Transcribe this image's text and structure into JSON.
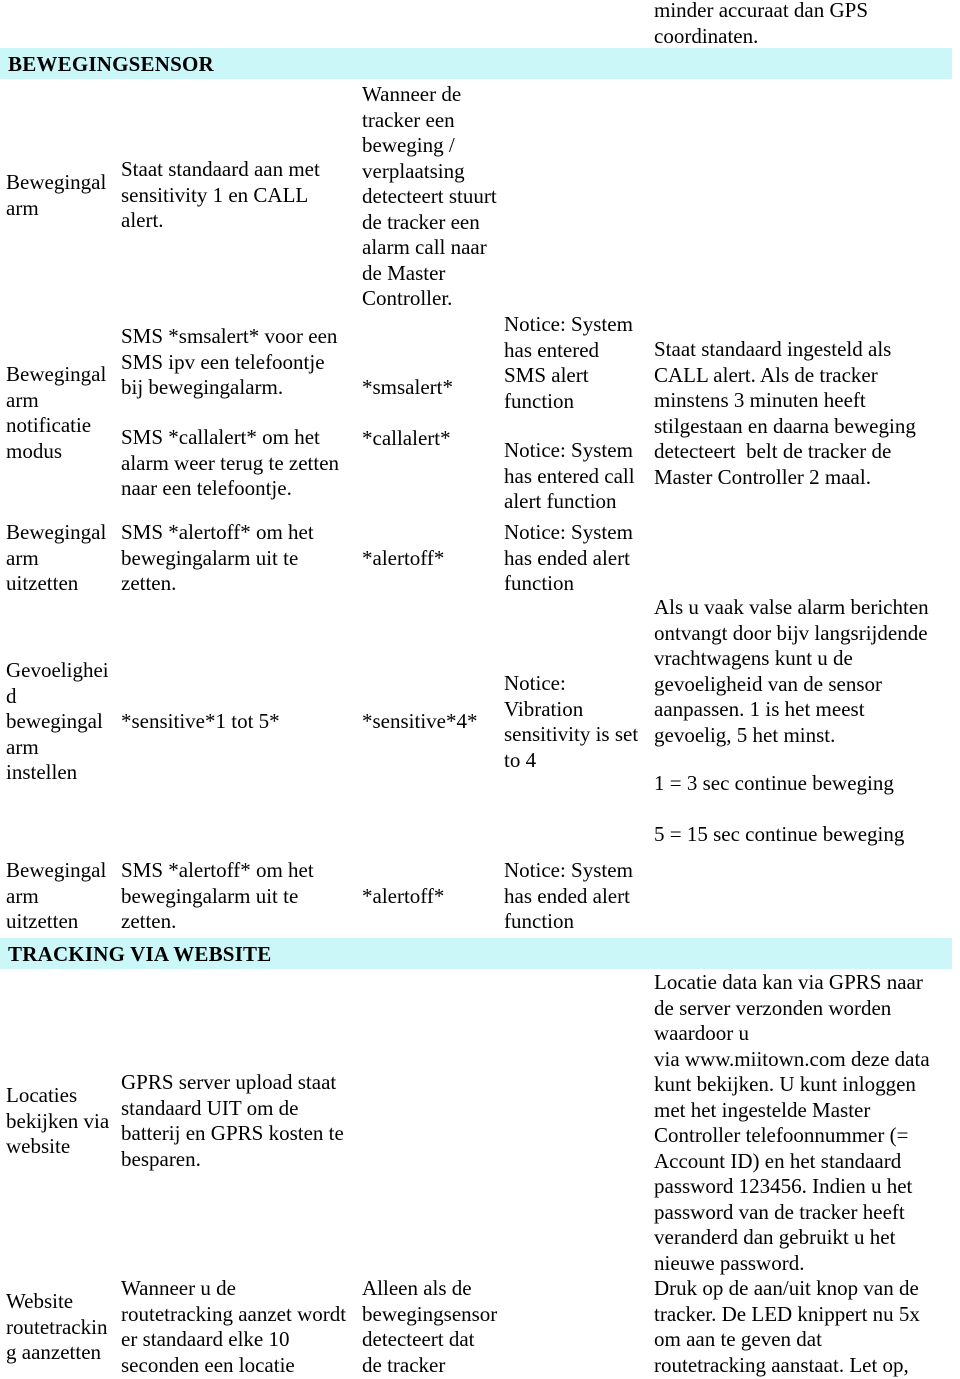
{
  "document": {
    "top_continuation": "minder accuraat dan GPS\ncoordinaten.",
    "sections": [
      {
        "id": "bewegingsensor",
        "heading": "BEWEGINGSENSOR",
        "rows": [
          {
            "id": "bewegingalarm-arm",
            "function": "Bewegingal\narm",
            "description": "Staat standaard aan met\nsensitivity 1 en CALL\nalert.",
            "command": "",
            "response_top": "Wanneer de\ntracker een\nbeweging /\nverplaatsing\ndetecteert stuurt\nde tracker een\nalarm call naar\nde Master\nController.",
            "notice": "",
            "remarks": ""
          },
          {
            "id": "bewegingalarm-notificatie-modus",
            "function": "Bewegingal\narm\nnotificatie\nmodus",
            "description_1": "SMS *smsalert* voor een\nSMS ipv een telefoontje\nbij bewegingalarm.",
            "description_2": "SMS *callalert* om het\nalarm weer terug te zetten\nnaar een telefoontje.",
            "command_1": "*smsalert*",
            "command_2": "*callalert*",
            "notice_1": "Notice: System\nhas entered\nSMS alert\nfunction",
            "notice_2": "Notice: System\nhas entered call\nalert function",
            "remarks": "Staat standaard ingesteld als\nCALL alert. Als de tracker\nminstens 3 minuten heeft\nstilgestaan en daarna beweging\ndetecteert  belt de tracker de\nMaster Controller 2 maal."
          },
          {
            "id": "bewegingalarm-uitzetten-1",
            "function": "Bewegingal\narm\nuitzetten",
            "description": "SMS *alertoff* om het\nbewegingalarm uit te\nzetten.",
            "command": "*alertoff*",
            "notice": "Notice: System\nhas ended alert\nfunction",
            "remarks": ""
          },
          {
            "id": "gevoeligheid-instellen",
            "function": "Gevoelighei\nd\nbewegingal\narm\ninstellen",
            "description": "*sensitive*1 tot 5*",
            "command": "*sensitive*4*",
            "notice": "Notice:\nVibration\nsensitivity is set\nto 4",
            "remarks_1": "Als u vaak valse alarm berichten\nontvangt door bijv langsrijdende\nvrachtwagens kunt u de\ngevoeligheid van de sensor\naanpassen. 1 is het meest\ngevoelig, 5 het minst.",
            "remarks_2": "1 = 3 sec continue beweging",
            "remarks_3": "5 = 15 sec continue beweging"
          },
          {
            "id": "bewegingalarm-uitzetten-2",
            "function": "Bewegingal\narm\nuitzetten",
            "description": "SMS *alertoff* om het\nbewegingalarm uit te\nzetten.",
            "command": "*alertoff*",
            "notice": "Notice: System\nhas ended alert\nfunction",
            "remarks": ""
          }
        ]
      },
      {
        "id": "tracking-via-website",
        "heading": "TRACKING VIA WEBSITE",
        "rows": [
          {
            "id": "locaties-bekijken-via-website",
            "function": "Locaties\nbekijken via\nwebsite",
            "description": "GPRS server upload staat\nstandaard UIT om de\nbatterij en GPRS kosten te\nbesparen.",
            "command": "",
            "notice": "",
            "remarks": "Locatie data kan via GPRS naar\nde server verzonden worden\nwaardoor u\nvia www.miitown.com deze data\nkunt bekijken. U kunt inloggen\nmet het ingestelde Master\nController telefoonnummer (=\nAccount ID) en het standaard\npassword 123456. Indien u het\npassword van de tracker heeft\nveranderd dan gebruikt u het\nnieuwe password."
          },
          {
            "id": "website-routetracking-aanzetten",
            "function": "Website\nroutetrackin\ng aanzetten",
            "description": "Wanneer u de\nroutetracking aanzet wordt\ner standaard elke 10\nseconden een locatie",
            "command": "Alleen als de\nbewegingsensor\ndetecteert dat\nde tracker",
            "notice": "",
            "remarks": "Druk op de aan/uit knop van de\ntracker. De LED knippert nu 5x\nom aan te geven dat\nroutetracking aanstaat. Let op,"
          }
        ]
      }
    ]
  },
  "colors": {
    "section_band": "#ccf7f9",
    "text": "#000000",
    "page_background": "#ffffff"
  }
}
